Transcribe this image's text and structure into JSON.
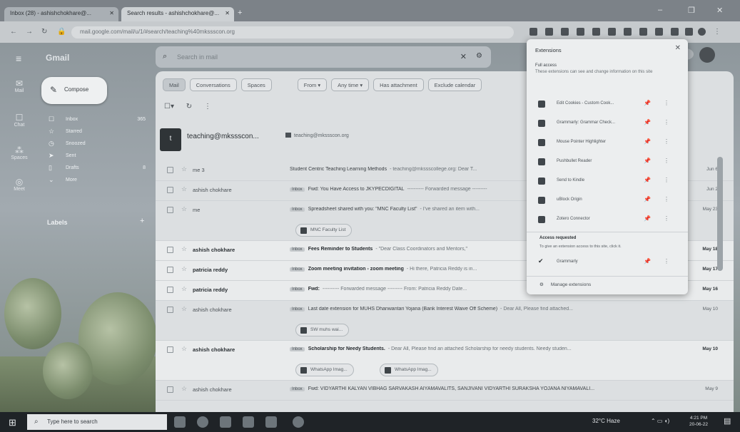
{
  "browser": {
    "tabs": [
      {
        "label": "Inbox (28) - ashishchokhare@..."
      },
      {
        "label": "Search results - ashishchokhare@..."
      }
    ],
    "new_tab": "+",
    "url": "mail.google.com/mail/u/1/#search/teaching%40mkssscon.org",
    "minimize": "–",
    "maximize": "❐",
    "close": "✕"
  },
  "gmail": {
    "logo": "Gmail",
    "search_placeholder": "Search in mail",
    "compose_label": "Compose",
    "rail": [
      {
        "icon": "✉",
        "label": "Mail"
      },
      {
        "icon": "☐",
        "label": "Chat"
      },
      {
        "icon": "⁂",
        "label": "Spaces"
      },
      {
        "icon": "◎",
        "label": "Meet"
      }
    ],
    "folders": [
      {
        "icon": "☐",
        "label": "Inbox",
        "count": "365"
      },
      {
        "icon": "☆",
        "label": "Starred",
        "count": ""
      },
      {
        "icon": "◷",
        "label": "Snoozed",
        "count": ""
      },
      {
        "icon": "➤",
        "label": "Sent",
        "count": ""
      },
      {
        "icon": "▯",
        "label": "Drafts",
        "count": "8"
      },
      {
        "icon": "⌄",
        "label": "More",
        "count": ""
      }
    ],
    "labels_heading": "Labels",
    "labels_add": "+",
    "filter_chips": [
      "Mail",
      "Conversations",
      "Spaces",
      "From ▾",
      "Any time ▾",
      "Has attachment",
      "Exclude calendar"
    ],
    "toolbar": {
      "select": "☐▾",
      "refresh": "↻",
      "more": "⋮"
    },
    "top_result": {
      "name": "teaching@mkssscon...",
      "email": "teaching@mkssscon.org",
      "avatar_letter": "t"
    },
    "rows": [
      {
        "sender": "me 3",
        "label": "",
        "subject": "Student Centric Teaching Learning Methods",
        "snippet": "- teaching@mkssscollege.org: Dear T...",
        "date": "Jun 6",
        "unread": false,
        "attachments": []
      },
      {
        "sender": "ashish chokhare",
        "label": "Inbox",
        "subject": "Fwd: You Have Access to JKYPECDIGITAL",
        "snippet": "---------- Forwarded message ---------",
        "date": "Jun 2",
        "unread": false,
        "attachments": []
      },
      {
        "sender": "me",
        "label": "Inbox",
        "subject": "Spreadsheet shared with you: \"MNC Faculty List\"",
        "snippet": "- I've shared an item with...",
        "date": "May 23",
        "unread": false,
        "attachments": [
          "MNC Faculty List"
        ]
      },
      {
        "sender": "ashish chokhare",
        "label": "Inbox",
        "subject": "Fees Reminder to Students",
        "snippet": "- \"Dear Class Coordinators and Mentors,\"",
        "date": "May 18",
        "unread": true,
        "attachments": []
      },
      {
        "sender": "patricia reddy",
        "label": "Inbox",
        "subject": "Zoom meeting invitation - zoom meeting",
        "snippet": "- Hi there, Patricia Reddy is in...",
        "date": "May 17",
        "unread": true,
        "attachments": []
      },
      {
        "sender": "patricia reddy",
        "label": "Inbox",
        "subject": "Fwd:",
        "snippet": "---------- Forwarded message --------- From: Patricia Reddy Date...",
        "date": "May 16",
        "unread": true,
        "attachments": []
      },
      {
        "sender": "ashish chokhare",
        "label": "Inbox",
        "subject": "Last date extension for MUHS Dhanwantari Yojana (Bank Interest Waive Off Scheme)",
        "snippet": "- Dear All, Please find attached...",
        "date": "May 10",
        "unread": false,
        "attachments": [
          "SW muhs wai..."
        ]
      },
      {
        "sender": "ashish chokhare",
        "label": "Inbox",
        "subject": "Scholarship for Needy Students.",
        "snippet": "- Dear All, Please find an attached Scholarship for needy students. Needy studen...",
        "date": "May 10",
        "unread": true,
        "attachments": [
          "WhatsApp Imag...",
          "WhatsApp Imag..."
        ]
      },
      {
        "sender": "ashish chokhare",
        "label": "Inbox",
        "subject": "Fwd: VIDYARTHI KALYAN VIBHAG SARVAKASH AIYAMAVALITS, SANJIVANI VIDYARTHI SURAKSHA YOJANA NIYAMAVALI...",
        "snippet": "",
        "date": "May 9",
        "unread": false,
        "attachments": []
      }
    ]
  },
  "extensions_popup": {
    "title": "Extensions",
    "close": "✕",
    "full_access": "Full access",
    "full_access_desc": "These extensions can see and change information on this site",
    "items": [
      {
        "name": "Edit Cookies - Custom Cook...",
        "pin": "📌",
        "more": "⋮"
      },
      {
        "name": "Grammarly: Grammar Check...",
        "pin": "📌",
        "more": "⋮"
      },
      {
        "name": "Mouse Pointer Highlighter",
        "pin": "📌",
        "more": "⋮"
      },
      {
        "name": "Pushbullet Reader",
        "pin": "📌",
        "more": "⋮"
      },
      {
        "name": "Send to Kindle",
        "pin": "📌",
        "more": "⋮"
      },
      {
        "name": "uBlock Origin",
        "pin": "📌",
        "more": "⋮"
      },
      {
        "name": "Zotero Connector",
        "pin": "📌",
        "more": "⋮"
      }
    ],
    "access_requested": "Access requested",
    "access_requested_desc": "To give an extension access to this site, click it.",
    "requested_items": [
      {
        "name": "Grammarly",
        "pin": "📌",
        "more": "⋮"
      }
    ],
    "manage": "Manage extensions"
  },
  "taskbar": {
    "search_placeholder": "Type here to search",
    "weather": "32°C Haze",
    "time": "4:21 PM",
    "date": "20-06-22"
  }
}
